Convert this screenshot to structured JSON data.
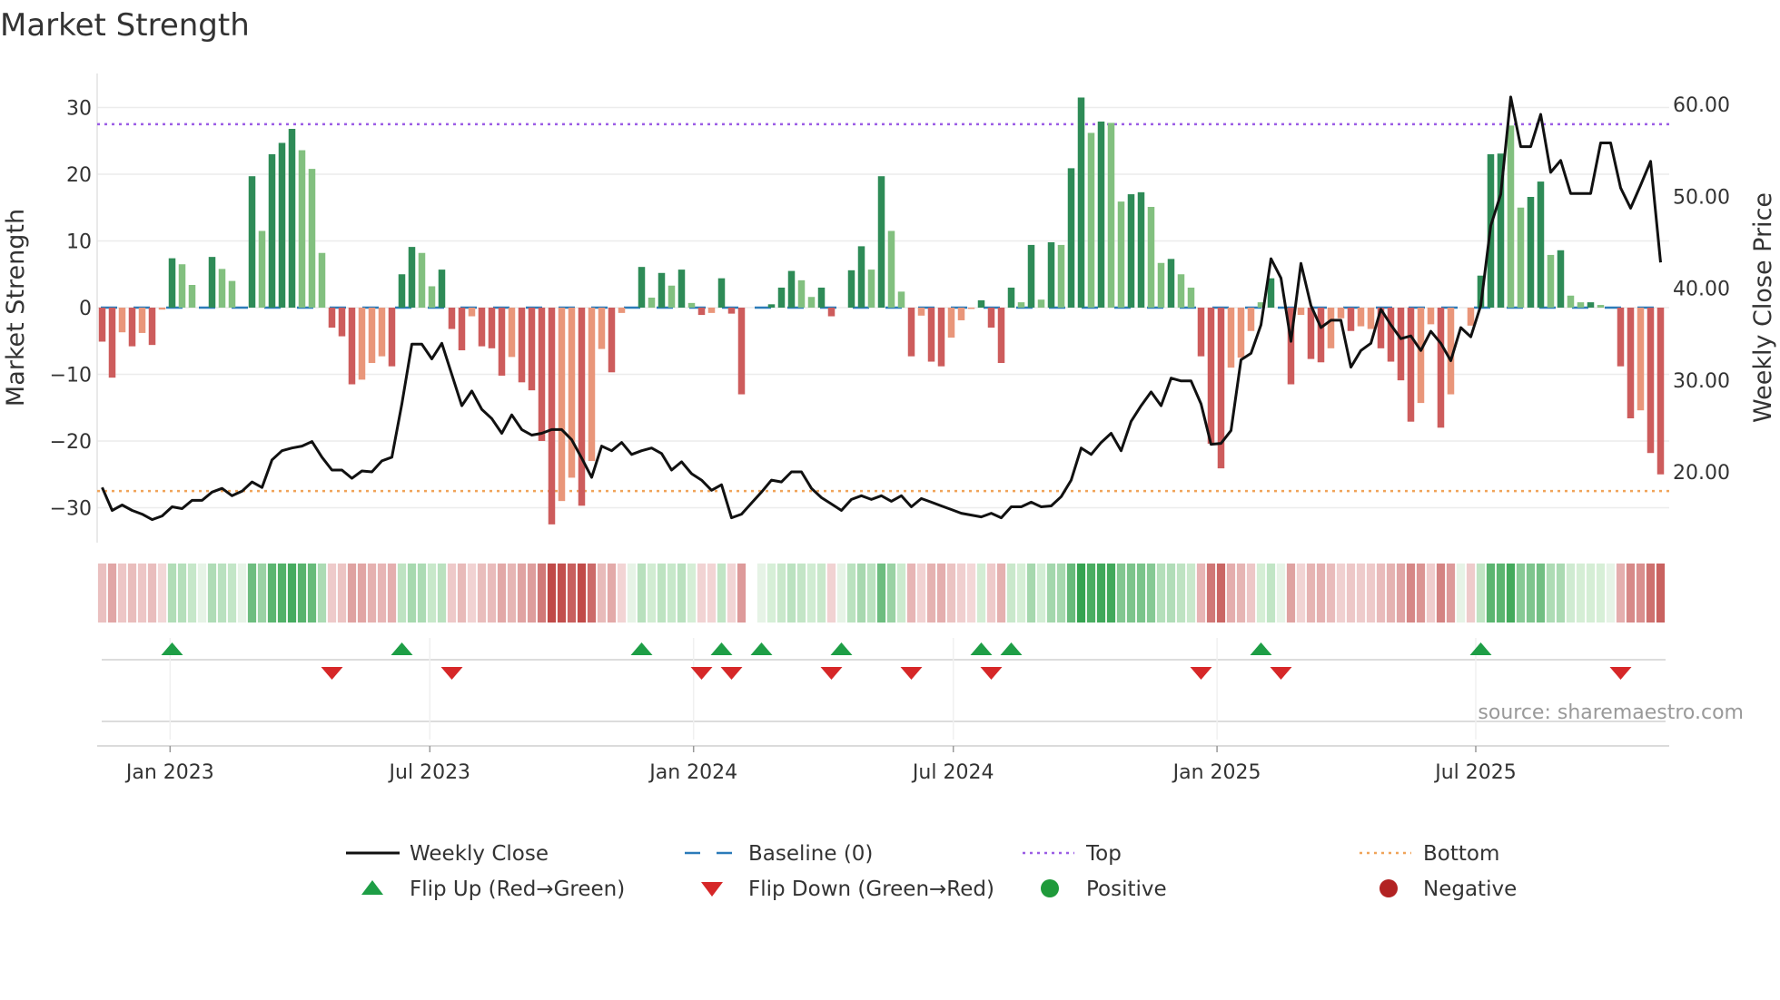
{
  "chart_data": {
    "type": "bar",
    "title": "Market Strength",
    "ylabel": "Market Strength",
    "y2label": "Weekly Close Price",
    "ylim": [
      -35,
      35
    ],
    "y_ticks": [
      30,
      20,
      10,
      0,
      -10,
      -20,
      -30
    ],
    "y2lim": [
      12.9,
      65
    ],
    "y2_ticks": [
      "60.00",
      "50.00",
      "40.00",
      "30.00",
      "20.00"
    ],
    "y2_tick_values": [
      60,
      50,
      40,
      30,
      20
    ],
    "x_ticks": [
      {
        "label": "Jan 2023",
        "week": 6.8
      },
      {
        "label": "Jul 2023",
        "week": 32.8
      },
      {
        "label": "Jan 2024",
        "week": 59.2
      },
      {
        "label": "Jul 2024",
        "week": 85.2
      },
      {
        "label": "Jan 2025",
        "week": 111.6
      },
      {
        "label": "Jul 2025",
        "week": 137.5
      }
    ],
    "top_level": 27.5,
    "bottom_level": -27.5,
    "strength": [
      -5.1,
      -10.5,
      -3.7,
      -5.8,
      -3.8,
      -5.6,
      -0.3,
      7.4,
      6.5,
      3.4,
      0,
      7.6,
      5.8,
      4.0,
      0,
      19.7,
      11.5,
      23,
      24.7,
      26.8,
      23.6,
      20.8,
      8.2,
      -3,
      -4.3,
      -11.5,
      -10.8,
      -8.3,
      -7.3,
      -8.8,
      5,
      9.1,
      8.2,
      3.2,
      5.7,
      -3.2,
      -6.4,
      -1.3,
      -5.8,
      -6.1,
      -10.2,
      -7.4,
      -11.2,
      -12.4,
      -20,
      -32.5,
      -29,
      -25.5,
      -29.7,
      -23,
      -6.2,
      -9.7,
      -0.8,
      0,
      6.1,
      1.5,
      5.2,
      3.3,
      5.7,
      0.7,
      -1.1,
      -0.8,
      4.4,
      -0.9,
      -13,
      null,
      0,
      0.5,
      3,
      5.5,
      4.1,
      1.6,
      3,
      -1.3,
      0,
      5.6,
      9.2,
      5.7,
      19.7,
      11.5,
      2.4,
      -7.3,
      -1.2,
      -8.1,
      -8.8,
      -4.5,
      -1.9,
      -0.2,
      1.1,
      -3,
      -8.3,
      3,
      0.8,
      9.4,
      1.2,
      9.8,
      9.4,
      20.9,
      31.5,
      26.2,
      27.9,
      27.7,
      15.9,
      17,
      17.3,
      15.1,
      6.7,
      7.3,
      5,
      3,
      -7.3,
      -20.4,
      -24.1,
      -9,
      -7.5,
      -3.5,
      0.8,
      4.4,
      0,
      -11.5,
      -1.1,
      -7.7,
      -8.2,
      -6.1,
      -1.6,
      -3.5,
      -2.8,
      -3.2,
      -6.1,
      -8.1,
      -10.9,
      -17.1,
      -14.3,
      -2.5,
      -18,
      -13,
      0,
      -2.7,
      4.8,
      23,
      23.1,
      27.3,
      15,
      16.6,
      18.9,
      7.9,
      8.6,
      1.8,
      0.8,
      0.8,
      0.4,
      0,
      -8.8,
      -16.6,
      -15.4,
      -21.8,
      -25
    ],
    "strength_tone": "DDLDLDLDLLDDLLDDLDDDLLLDDDLLLDDDLLDDDLDDDLDDDDLLDLLDLDDLDLDLDLDDDDDDDDLLDDDDDLDLLDLDDLLLDDDDLDLDLDDLDLLDDLLDLLDDDLLLLDDDLDDLLDLLDDDDLLDLDLDDDLLDDLDLLDLDDDLDD",
    "weekly_close": [
      18.3,
      15.8,
      16.4,
      15.8,
      15.4,
      14.8,
      15.2,
      16.2,
      16.0,
      16.9,
      16.9,
      17.8,
      18.2,
      17.4,
      17.9,
      18.9,
      18.3,
      21.3,
      22.3,
      22.6,
      22.8,
      23.3,
      21.6,
      20.2,
      20.2,
      19.3,
      20.1,
      20.0,
      21.2,
      21.6,
      27.4,
      33.9,
      33.9,
      32.3,
      34.0,
      30.6,
      27.2,
      28.8,
      26.8,
      25.8,
      24.2,
      26.2,
      24.6,
      24.0,
      24.2,
      24.6,
      24.6,
      23.5,
      21.5,
      19.4,
      22.8,
      22.3,
      23.2,
      21.9,
      22.3,
      22.6,
      22.0,
      20.2,
      21.1,
      19.8,
      19.1,
      18.0,
      18.6,
      15.0,
      15.4,
      16.6,
      17.8,
      19.1,
      18.9,
      20.0,
      20.0,
      18.2,
      17.2,
      16.5,
      15.8,
      17.0,
      17.4,
      17.0,
      17.4,
      16.8,
      17.4,
      16.2,
      17.1,
      16.7,
      16.3,
      15.9,
      15.5,
      15.3,
      15.1,
      15.5,
      15.0,
      16.2,
      16.2,
      16.7,
      16.2,
      16.3,
      17.3,
      19.1,
      22.6,
      21.9,
      23.2,
      24.2,
      22.3,
      25.5,
      27.2,
      28.7,
      27.2,
      30.2,
      29.9,
      29.9,
      27.4,
      23.0,
      23.1,
      24.5,
      32.2,
      32.9,
      36.0,
      43.2,
      41.1,
      34.2,
      42.7,
      38.1,
      35.7,
      36.5,
      36.5,
      31.4,
      33.2,
      34.0,
      37.7,
      36.0,
      34.5,
      34.8,
      33.2,
      35.3,
      34.0,
      32.1,
      35.7,
      34.7,
      38.1,
      46.8,
      50.2,
      60.8,
      55.4,
      55.4,
      58.9,
      52.6,
      53.9,
      50.3,
      50.3,
      50.3,
      55.8,
      55.8,
      50.9,
      48.7,
      51.2,
      53.8,
      42.8
    ],
    "flip_up_weeks": [
      7,
      30,
      54,
      62,
      66,
      74,
      88,
      91,
      116,
      138
    ],
    "flip_down_weeks": [
      23,
      35,
      60,
      63,
      73,
      81,
      89,
      110,
      118,
      152
    ],
    "legend": [
      {
        "label": "Weekly Close",
        "kind": "line"
      },
      {
        "label": "Baseline (0)",
        "kind": "baseline"
      },
      {
        "label": "Top",
        "kind": "top"
      },
      {
        "label": "Bottom",
        "kind": "bottom"
      },
      {
        "label": "Flip Up (Red→Green)",
        "kind": "up"
      },
      {
        "label": "Flip Down (Green→Red)",
        "kind": "down"
      },
      {
        "label": "Positive",
        "kind": "pos"
      },
      {
        "label": "Negative",
        "kind": "neg"
      }
    ],
    "legend_position": "bottom-center",
    "grid": true
  },
  "source": "source: sharemaestro.com",
  "colors": {
    "pos_dark": "#2e8b57",
    "pos_light": "#82c07f",
    "neg_dark": "#cd5c5c",
    "neg_light": "#e9967a",
    "baseline": "#2b7bb9",
    "top": "#9b5de5",
    "bottom": "#f0a45a",
    "up": "#1e9e46",
    "down": "#d62728",
    "line": "#111111",
    "pos_dot": "#1f9a3a",
    "neg_dot": "#b22222"
  }
}
